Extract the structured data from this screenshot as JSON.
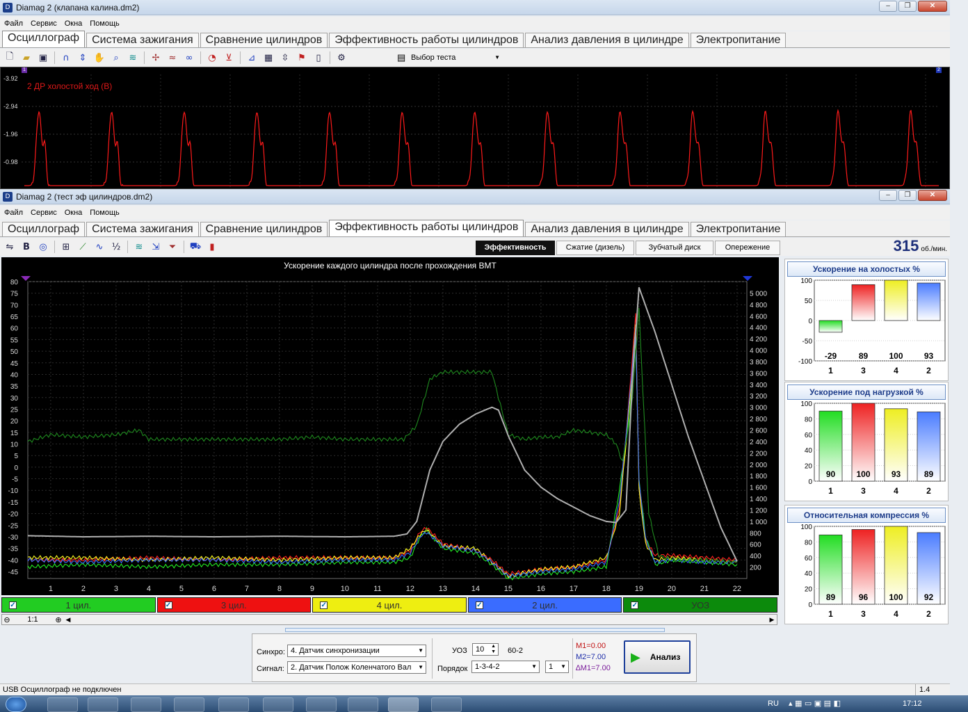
{
  "win1": {
    "title": "Diamag 2 (клапана калина.dm2)"
  },
  "win2": {
    "title": "Diamag 2 (тест эф цилиндров.dm2)"
  },
  "menu": [
    "Файл",
    "Сервис",
    "Окна",
    "Помощь"
  ],
  "tabs": [
    "Осциллограф",
    "Система зажигания",
    "Сравнение цилиндров",
    "Эффективность работы цилиндров",
    "Анализ давления в цилиндре",
    "Электропитание"
  ],
  "toolbar1": {
    "test_select": "Выбор теста"
  },
  "osc": {
    "label": "2 ДР холостой ход (В)",
    "yticks": [
      "-3.92",
      "-2.94",
      "-1.96",
      "-0.98",
      "0"
    ],
    "marker_left": "1",
    "marker_right": "2",
    "color": "#ff1a1a"
  },
  "subtabs": [
    "Эффективность",
    "Сжатие (дизель)",
    "Зубчатый диск",
    "Опережение"
  ],
  "rpm": {
    "value": "315",
    "unit": "об./мин."
  },
  "chart_data": {
    "type": "line",
    "title": "Ускорение каждого цилиндра после прохождения ВМТ",
    "x_ticks": [
      "1",
      "2",
      "3",
      "4",
      "5",
      "6",
      "7",
      "8",
      "9",
      "10",
      "11",
      "12",
      "13",
      "14",
      "15",
      "16",
      "17",
      "18",
      "19",
      "20",
      "21",
      "22"
    ],
    "xlim": [
      0.3,
      22.3
    ],
    "y_left_ticks": [
      "80",
      "75",
      "70",
      "65",
      "60",
      "55",
      "50",
      "45",
      "40",
      "35",
      "30",
      "25",
      "20",
      "15",
      "10",
      "5",
      "0",
      "-5",
      "-10",
      "-15",
      "-20",
      "-25",
      "-30",
      "-35",
      "-40",
      "-45"
    ],
    "ylim_left": [
      -48,
      80
    ],
    "y_right_ticks": [
      "5 000",
      "4 800",
      "4 600",
      "4 400",
      "4 200",
      "4 000",
      "3 800",
      "3 600",
      "3 400",
      "3 200",
      "3 000",
      "2 800",
      "2 600",
      "2 400",
      "2 200",
      "2 000",
      "1 800",
      "1 600",
      "1 400",
      "1 200",
      "1 000",
      "800",
      "600",
      "400",
      "200"
    ],
    "ylim_right": [
      0,
      5200
    ],
    "series": [
      {
        "name": "1 цил.",
        "color": "#22ee22",
        "x": [
          0.3,
          2,
          4,
          6,
          8,
          10,
          11.5,
          12,
          12.3,
          12.5,
          13,
          14,
          14.5,
          15,
          16,
          17,
          18,
          18.4,
          18.7,
          18.9,
          19,
          19.2,
          19.5,
          20,
          21,
          22
        ],
        "y": [
          -43,
          -42,
          -43,
          -42,
          -42,
          -41,
          -41,
          -39,
          -30,
          -27,
          -35,
          -37,
          -42,
          -48,
          -46,
          -45,
          -43,
          -10,
          20,
          55,
          -5,
          -30,
          -42,
          -40,
          -41,
          -42
        ]
      },
      {
        "name": "3 цил.",
        "color": "#ff2020",
        "x": [
          0.3,
          2,
          4,
          6,
          8,
          10,
          11.5,
          12,
          12.3,
          12.5,
          13,
          14,
          14.5,
          15,
          16,
          17,
          18,
          18.4,
          18.7,
          18.9,
          19,
          19.2,
          19.5,
          20,
          21,
          22
        ],
        "y": [
          -40,
          -40,
          -39,
          -40,
          -39,
          -39,
          -39,
          -36,
          -28,
          -26,
          -33,
          -36,
          -40,
          -46,
          -44,
          -43,
          -40,
          -18,
          30,
          66,
          -8,
          -32,
          -38,
          -38,
          -39,
          -40
        ]
      },
      {
        "name": "4 цил.",
        "color": "#ffff20",
        "x": [
          0.3,
          2,
          4,
          6,
          8,
          10,
          11.5,
          12,
          12.3,
          12.5,
          13,
          14,
          14.5,
          15,
          16,
          17,
          18,
          18.4,
          18.7,
          18.9,
          19,
          19.2,
          19.5,
          20,
          21,
          22
        ],
        "y": [
          -39,
          -39,
          -40,
          -39,
          -40,
          -39,
          -39,
          -35,
          -29,
          -27,
          -34,
          -35,
          -41,
          -47,
          -44,
          -43,
          -39,
          -20,
          25,
          62,
          -10,
          -33,
          -40,
          -39,
          -40,
          -41
        ]
      },
      {
        "name": "2 цил.",
        "color": "#3a6cff",
        "x": [
          0.3,
          2,
          4,
          6,
          8,
          10,
          11.5,
          12,
          12.3,
          12.5,
          13,
          14,
          14.5,
          15,
          16,
          17,
          18,
          18.4,
          18.7,
          18.9,
          19,
          19.2,
          19.5,
          20,
          21,
          22
        ],
        "y": [
          -40,
          -41,
          -40,
          -40,
          -41,
          -40,
          -40,
          -37,
          -30,
          -28,
          -34,
          -36,
          -41,
          -47,
          -45,
          -44,
          -41,
          -15,
          28,
          60,
          -6,
          -31,
          -41,
          -40,
          -41,
          -41
        ]
      },
      {
        "name": "УОЗ",
        "color": "#1f8a1f",
        "axis": "left",
        "x": [
          0.3,
          1,
          2,
          3,
          3.7,
          4,
          5,
          6,
          7,
          8,
          9,
          10,
          11,
          11.8,
          12.2,
          12.6,
          13,
          14,
          14.5,
          14.7,
          15,
          15.5,
          16,
          16.5,
          17,
          17.5,
          18,
          18.3,
          18.5,
          18.8,
          19,
          19.3,
          19.6,
          20,
          21,
          22
        ],
        "y": [
          11,
          14,
          13,
          14,
          16,
          12,
          12,
          12,
          12,
          12,
          13,
          12,
          12,
          12,
          18,
          38,
          41,
          41,
          41,
          30,
          14,
          12,
          13,
          13,
          16,
          15,
          14,
          10,
          2,
          30,
          68,
          -20,
          -38,
          -40,
          -40,
          -41
        ]
      },
      {
        "name": "RPM",
        "color": "#b0b0b0",
        "axis": "right",
        "x": [
          0.3,
          2,
          4,
          6,
          8,
          10,
          11.5,
          11.9,
          12.2,
          12.6,
          13,
          13.5,
          14,
          14.5,
          14.7,
          15,
          15.5,
          16,
          16.5,
          17,
          17.5,
          18,
          18.3,
          18.6,
          18.8,
          19,
          19.5,
          20,
          20.5,
          21,
          21.5,
          22
        ],
        "y": [
          750,
          730,
          740,
          730,
          740,
          730,
          740,
          780,
          1000,
          1900,
          2400,
          2700,
          2880,
          3000,
          2950,
          2500,
          1900,
          1600,
          1400,
          1250,
          1100,
          1000,
          980,
          1200,
          3500,
          5100,
          4300,
          3400,
          2500,
          1700,
          900,
          300
        ]
      }
    ]
  },
  "legend": [
    {
      "label": "1 цил.",
      "color": "#22cc22"
    },
    {
      "label": "3 цил.",
      "color": "#ee1111"
    },
    {
      "label": "4 цил.",
      "color": "#eeee11"
    },
    {
      "label": "2 цил.",
      "color": "#3a6cff"
    },
    {
      "label": "УОЗ",
      "color": "#0c8a0c"
    }
  ],
  "scroll": {
    "zoom": "1:1"
  },
  "bar_charts": [
    {
      "title": "Ускорение на холостых %",
      "yticks": [
        "100",
        "50",
        "0",
        "-50",
        "-100"
      ],
      "ymin": -100,
      "ymax": 100,
      "categories": [
        "1",
        "3",
        "4",
        "2"
      ],
      "values": [
        -29,
        89,
        100,
        93
      ],
      "labels": [
        "-29",
        "89",
        "100",
        "93"
      ],
      "colors": [
        "#22dd22",
        "#ee2222",
        "#eeee22",
        "#4a7cff"
      ]
    },
    {
      "title": "Ускорение под нагрузкой %",
      "yticks": [
        "100",
        "80",
        "60",
        "40",
        "20",
        "0"
      ],
      "ymin": 0,
      "ymax": 100,
      "categories": [
        "1",
        "3",
        "4",
        "2"
      ],
      "values": [
        90,
        100,
        93,
        89
      ],
      "labels": [
        "90",
        "100",
        "93",
        "89"
      ],
      "colors": [
        "#22dd22",
        "#ee2222",
        "#eeee22",
        "#4a7cff"
      ]
    },
    {
      "title": "Относительная компрессия %",
      "yticks": [
        "100",
        "80",
        "60",
        "40",
        "20",
        "0"
      ],
      "ymin": 0,
      "ymax": 100,
      "categories": [
        "1",
        "3",
        "4",
        "2"
      ],
      "values": [
        89,
        96,
        100,
        92
      ],
      "labels": [
        "89",
        "96",
        "100",
        "92"
      ],
      "colors": [
        "#22dd22",
        "#ee2222",
        "#eeee22",
        "#4a7cff"
      ]
    }
  ],
  "controls": {
    "sync_label": "Синхро:",
    "sync_value": "4.  Датчик синхронизации",
    "signal_label": "Сигнал:",
    "signal_value": "2.  Датчик Полож Коленчатого Вал",
    "uoz_label": "УОЗ",
    "uoz_value": "10",
    "teeth": "60-2",
    "order_label": "Порядок",
    "order_value": "1-3-4-2",
    "order_num": "1",
    "m1": "M1=0.00",
    "m2": "M2=7.00",
    "dm1": "∆M1=7.00",
    "analyze": "Анализ"
  },
  "status": {
    "left": "USB Осциллограф не подключен",
    "right": "1.4"
  },
  "taskbar": {
    "lang": "RU",
    "time": "17:12"
  }
}
